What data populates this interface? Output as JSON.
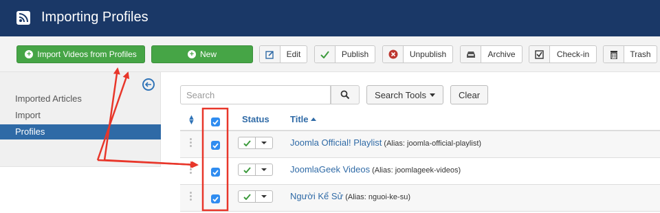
{
  "header": {
    "title": "Importing Profiles",
    "icon": "rss-icon"
  },
  "toolbar": {
    "import_label": "Import Videos from Profiles",
    "new_label": "New",
    "edit_label": "Edit",
    "publish_label": "Publish",
    "unpublish_label": "Unpublish",
    "archive_label": "Archive",
    "checkin_label": "Check-in",
    "trash_label": "Trash"
  },
  "sidebar": {
    "items": [
      {
        "label": "Imported Articles",
        "active": false
      },
      {
        "label": "Import",
        "active": false
      },
      {
        "label": "Profiles",
        "active": true
      }
    ]
  },
  "filters": {
    "search_placeholder": "Search",
    "search_tools_label": "Search Tools",
    "clear_label": "Clear"
  },
  "table": {
    "columns": {
      "status": "Status",
      "title": "Title"
    },
    "rows": [
      {
        "title": "Joomla Official! Playlist",
        "alias": "(Alias: joomla-official-playlist)",
        "checked": true,
        "published": true
      },
      {
        "title": "JoomlaGeek Videos",
        "alias": "(Alias: joomlageek-videos)",
        "checked": true,
        "published": true
      },
      {
        "title": "Người Kể Sử",
        "alias": "(Alias: nguoi-ke-su)",
        "checked": true,
        "published": true
      }
    ]
  },
  "colors": {
    "header_bg": "#1a3867",
    "primary_green": "#46a546",
    "link_blue": "#2f6aa6",
    "annotation_red": "#e8362a",
    "checkbox_blue": "#2f8cf0"
  }
}
